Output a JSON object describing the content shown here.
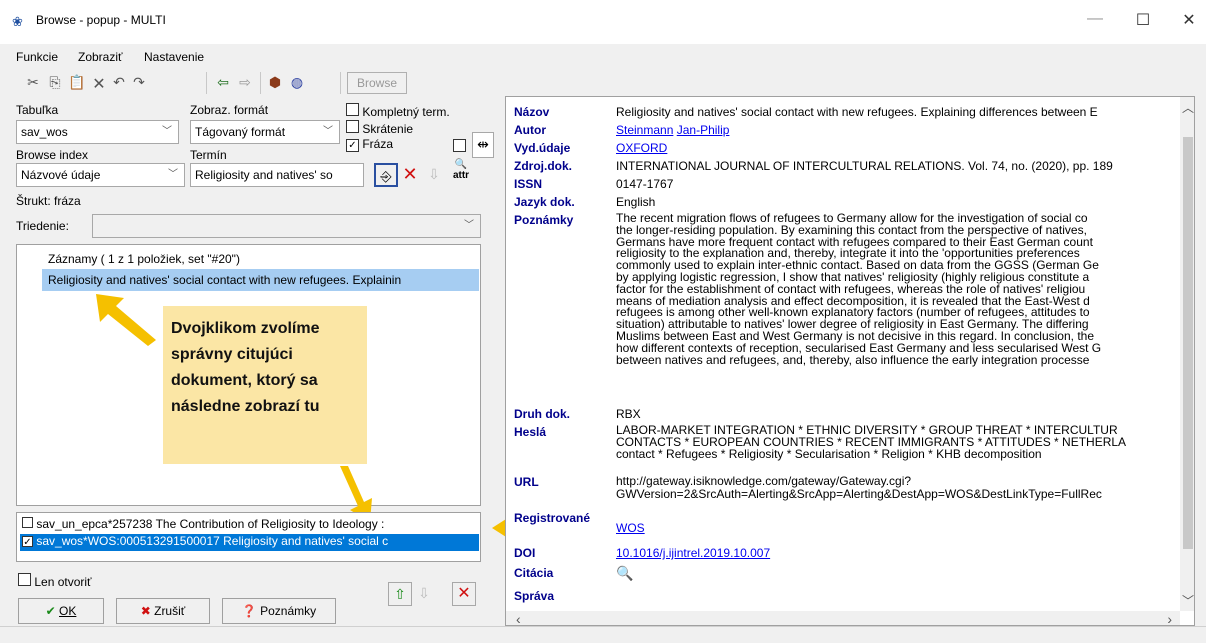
{
  "window": {
    "title": "Browse - popup - MULTI",
    "minimize": "—",
    "maximize": "☐",
    "close": "✕"
  },
  "menu": [
    "Funkcie",
    "Zobraziť",
    "Nastavenie"
  ],
  "toolbar": {
    "browse_label": "Browse"
  },
  "left": {
    "table_label": "Tabuľka",
    "table_value": "sav_wos",
    "format_label": "Zobraz. formát",
    "format_value": "Tágovaný formát",
    "complete_term_label": "Kompletný term.",
    "shortening_label": "Skrátenie",
    "phrase_label": "Fráza",
    "browse_index_label": "Browse index",
    "browse_index_value": "Názvové údaje",
    "term_label": "Termín",
    "term_value": "Religiosity and natives' so",
    "struct_label": "Štrukt: fráza",
    "sort_label": "Triedenie:",
    "records_header": "Záznamy ( 1 z 1  položiek, set \"#20\")",
    "record_selected": "Religiosity and natives' social contact with new refugees. Explainin",
    "note_text": "Dvojklikom zvolíme správny citujúci dokument, ktorý sa následne zobrazí tu",
    "bottom_items": [
      "sav_un_epca*257238   The Contribution of Religiosity to Ideology :",
      "sav_wos*WOS:000513291500017   Religiosity and natives' social c"
    ],
    "open_only_label": "Len otvoriť",
    "ok_label": "OK",
    "cancel_label": "Zrušiť",
    "notes_label": "Poznámky"
  },
  "record": {
    "title_label": "Názov",
    "title_value": "Religiosity and natives' social contact with new refugees. Explaining differences between E",
    "author_label": "Autor",
    "author_first": "Steinmann",
    "author_second": "Jan-Philip",
    "publisher_label": "Vyd.údaje",
    "publisher_value": "OXFORD",
    "source_label": "Zdroj.dok.",
    "source_value": "INTERNATIONAL JOURNAL OF INTERCULTURAL RELATIONS. Vol. 74, no. (2020), pp. 189",
    "issn_label": "ISSN",
    "issn_value": "0147-1767",
    "lang_label": "Jazyk dok.",
    "lang_value": "English",
    "notes_label": "Poznámky",
    "notes_lines": [
      "The recent migration flows of refugees to Germany allow for the investigation of social co",
      "the longer-residing population. By examining this contact from the perspective of natives,",
      "Germans have more frequent contact with refugees compared to their East German count",
      "religiosity to the explanation and, thereby, integrate it into the 'opportunities preferences",
      "commonly used to explain inter-ethnic contact. Based on data from the GGSS (German Ge",
      "by applying logistic regression, I show that natives' religiosity (highly religious constitute a",
      "factor for the establishment of contact with refugees, whereas the role of natives' religiou",
      "means of mediation analysis and effect decomposition, it is revealed that the East-West d",
      "refugees is among other well-known explanatory factors (number of refugees, attitudes to",
      "situation) attributable to natives' lower degree of religiosity in East Germany. The differing",
      "Muslims between East and West Germany is not decisive in this regard. In conclusion, the",
      "how different contexts of reception, secularised East Germany and less secularised West G",
      "between natives and refugees, and, thereby, also influence the early integration processe"
    ],
    "doctype_label": "Druh dok.",
    "doctype_value": "RBX",
    "keywords_label": "Heslá",
    "keywords_lines": [
      "LABOR-MARKET INTEGRATION * ETHNIC DIVERSITY * GROUP THREAT * INTERCULTUR",
      "CONTACTS * EUROPEAN COUNTRIES * RECENT IMMIGRANTS * ATTITUDES * NETHERLA",
      "contact * Refugees * Religiosity * Secularisation * Religion * KHB decomposition"
    ],
    "url_label": "URL",
    "url_lines": [
      "http://gateway.isiknowledge.com/gateway/Gateway.cgi?",
      "GWVersion=2&SrcAuth=Alerting&SrcApp=Alerting&DestApp=WOS&DestLinkType=FullRec"
    ],
    "registered_label": "Registrované",
    "registered_value": "WOS",
    "doi_label": "DOI",
    "doi_value": "10.1016/j.ijintrel.2019.10.007",
    "citation_label": "Citácia",
    "report_label": "Správa"
  }
}
